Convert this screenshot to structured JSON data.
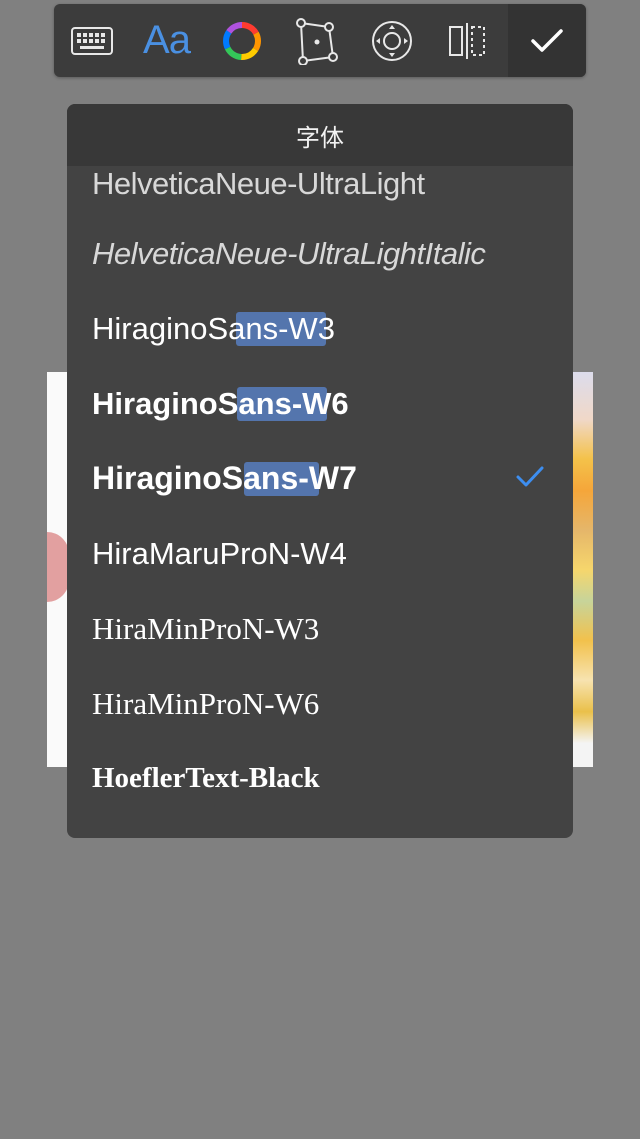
{
  "toolbar": {
    "items": [
      {
        "icon": "keyboard-icon"
      },
      {
        "icon": "font-icon",
        "label": "Aa"
      },
      {
        "icon": "color-wheel-icon"
      },
      {
        "icon": "transform-icon"
      },
      {
        "icon": "position-icon"
      },
      {
        "icon": "mirror-icon"
      },
      {
        "icon": "checkmark-icon"
      }
    ],
    "accent": "#4a90e2"
  },
  "font_picker": {
    "title": "字体",
    "selected_index": 4,
    "check_color": "#3d8ef0",
    "fonts": [
      {
        "name": "HelveticaNeue-UltraLight"
      },
      {
        "name": "HelveticaNeue-UltraLightItalic"
      },
      {
        "name": "HiraginoSans-W3"
      },
      {
        "name": "HiraginoSans-W6"
      },
      {
        "name": "HiraginoSans-W7"
      },
      {
        "name": "HiraMaruProN-W4"
      },
      {
        "name": "HiraMinProN-W3"
      },
      {
        "name": "HiraMinProN-W6"
      },
      {
        "name": "HoeflerText-Black"
      }
    ]
  }
}
